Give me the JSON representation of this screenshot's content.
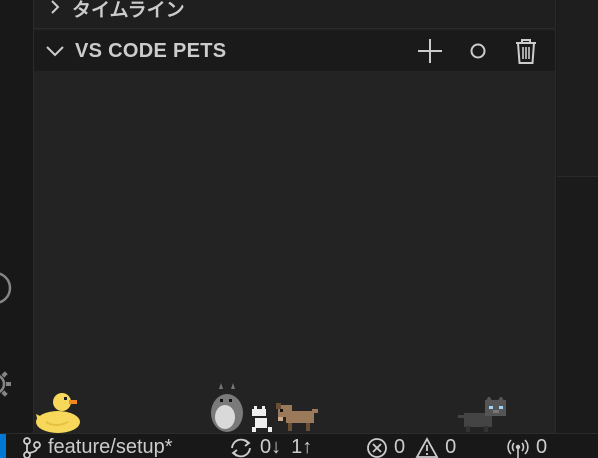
{
  "sidebar": {
    "timeline_section": {
      "title": "タイムライン",
      "expanded": false
    },
    "pets_section": {
      "title": "VS CODE PETS",
      "expanded": true,
      "actions": [
        {
          "name": "add-pet",
          "icon": "plus-icon"
        },
        {
          "name": "throw-ball",
          "icon": "circle-icon"
        },
        {
          "name": "remove-pet",
          "icon": "trash-icon"
        }
      ],
      "pets": [
        "rubber-duck",
        "totoro",
        "cat-black-white",
        "dog-brown",
        "cat-gray"
      ]
    }
  },
  "statusbar": {
    "branch": "feature/setup*",
    "sync_down": "0↓",
    "sync_up": "1↑",
    "errors": "0",
    "warnings": "0",
    "ports": "0"
  },
  "colors": {
    "sidebar_bg": "#1f1f1f",
    "pets_bg": "#232323",
    "accent": "#0078d4"
  }
}
